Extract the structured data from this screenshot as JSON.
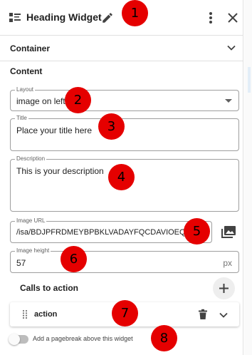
{
  "header": {
    "title": "Heading Widget"
  },
  "container_section": {
    "label": "Container"
  },
  "content_section": {
    "label": "Content",
    "layout": {
      "label": "Layout",
      "value": "image on left"
    },
    "title_field": {
      "label": "Title",
      "value": "Place your title here"
    },
    "description_field": {
      "label": "Description",
      "value": "This is your description"
    },
    "image_url": {
      "label": "Image URL",
      "value": "/isa/BDJPFRDMEYBPBKLVADAYFQCDAVIOEQJ"
    },
    "image_height": {
      "label": "Image height",
      "value": "57",
      "unit": "px"
    }
  },
  "calls_to_action": {
    "label": "Calls to action",
    "items": [
      {
        "label": "action"
      }
    ]
  },
  "pagebreak": {
    "label": "Add a pagebreak above this widget",
    "enabled": false
  },
  "markers": [
    "1",
    "2",
    "3",
    "4",
    "5",
    "6",
    "7",
    "8"
  ],
  "colors": {
    "marker": "#e50000",
    "border": "#9e9e9e",
    "text": "#212121"
  },
  "icons": [
    "widget-list-icon",
    "pencil-icon",
    "more-vert-icon",
    "close-icon",
    "chevron-down-icon",
    "dropdown-caret-icon",
    "image-icon",
    "plus-icon",
    "drag-handle-icon",
    "trash-icon"
  ]
}
